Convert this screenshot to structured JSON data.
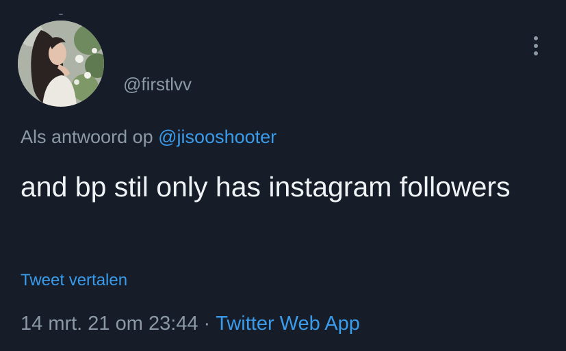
{
  "tweet": {
    "handle": "@firstlvv",
    "reply_prefix": "Als antwoord op",
    "reply_mention": "@jisooshooter",
    "text": "and bp stil only has instagram followers",
    "translate_label": "Tweet vertalen",
    "timestamp": "14 mrt. 21 om 23:44",
    "separator": "·",
    "source": "Twitter Web App"
  },
  "icons": {
    "menu": "more-vertical-icon",
    "avatar": "profile-photo"
  },
  "colors": {
    "background": "#161d28",
    "primary_text": "#f0f3f6",
    "secondary_text": "#8b98a5",
    "link": "#3a9bea"
  }
}
